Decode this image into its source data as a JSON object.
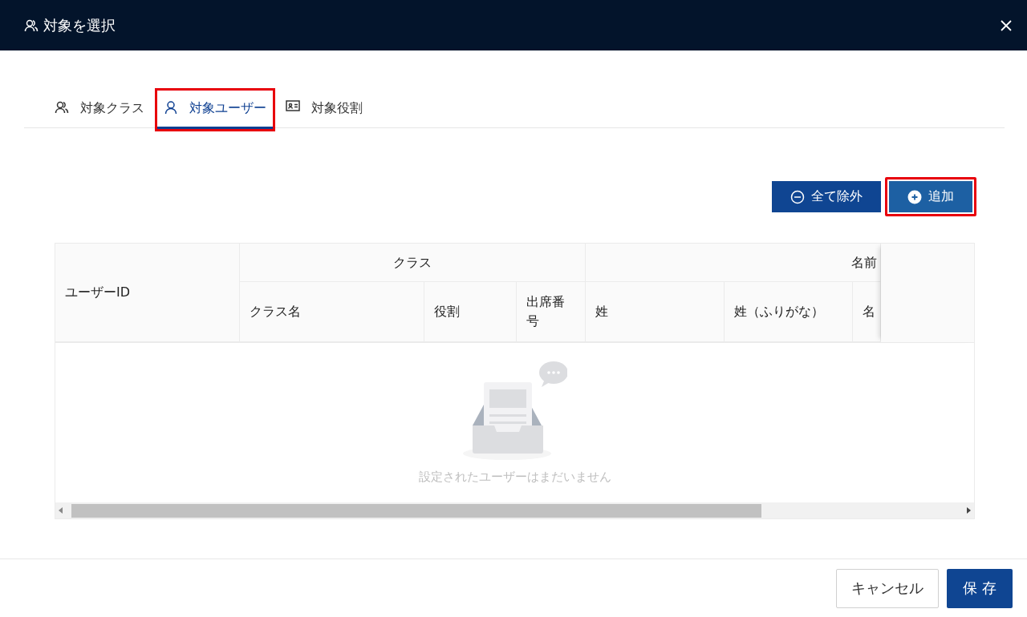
{
  "window": {
    "title": "対象を選択"
  },
  "tabs": [
    {
      "label": "対象クラス",
      "selected": false,
      "highlighted": false
    },
    {
      "label": "対象ユーザー",
      "selected": true,
      "highlighted": true
    },
    {
      "label": "対象役割",
      "selected": false,
      "highlighted": false
    }
  ],
  "toolbar": [
    {
      "label": "全て除外",
      "kind": "remove",
      "highlighted": false
    },
    {
      "label": "追加",
      "kind": "add",
      "highlighted": true
    }
  ],
  "table": {
    "id_column": "ユーザーID",
    "groups": [
      {
        "label": "クラス",
        "columns": [
          "クラス名",
          "役割",
          "出席番号"
        ]
      },
      {
        "label": "名前",
        "columns": [
          "姓",
          "姓（ふりがな）",
          "名"
        ]
      }
    ],
    "empty_text": "設定されたユーザーはまだいません"
  },
  "footer": {
    "cancel": "キャンセル",
    "save": "保 存"
  }
}
